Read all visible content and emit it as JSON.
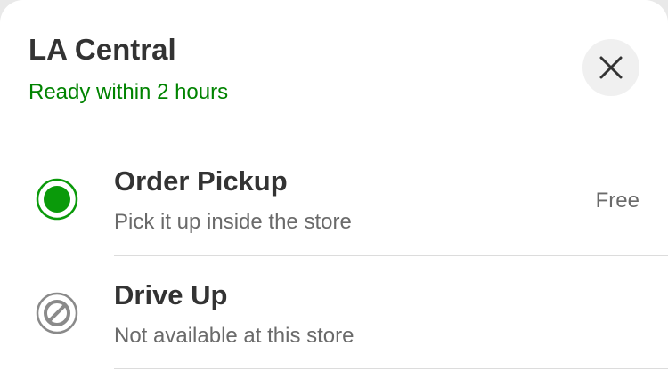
{
  "header": {
    "store_name": "LA Central",
    "ready_text": "Ready within 2 hours",
    "close_icon": "close-icon"
  },
  "options": [
    {
      "title": "Order Pickup",
      "subtitle": "Pick it up inside the store",
      "price": "Free",
      "state": "selected",
      "icon": "radio-selected-icon"
    },
    {
      "title": "Drive Up",
      "subtitle": "Not available at this store",
      "price": "",
      "state": "unavailable",
      "icon": "unavailable-icon"
    }
  ],
  "colors": {
    "accent_green": "#008300",
    "radio_fill": "#0a9a0a",
    "text_primary": "#333333",
    "text_secondary": "#6a6a6a"
  }
}
